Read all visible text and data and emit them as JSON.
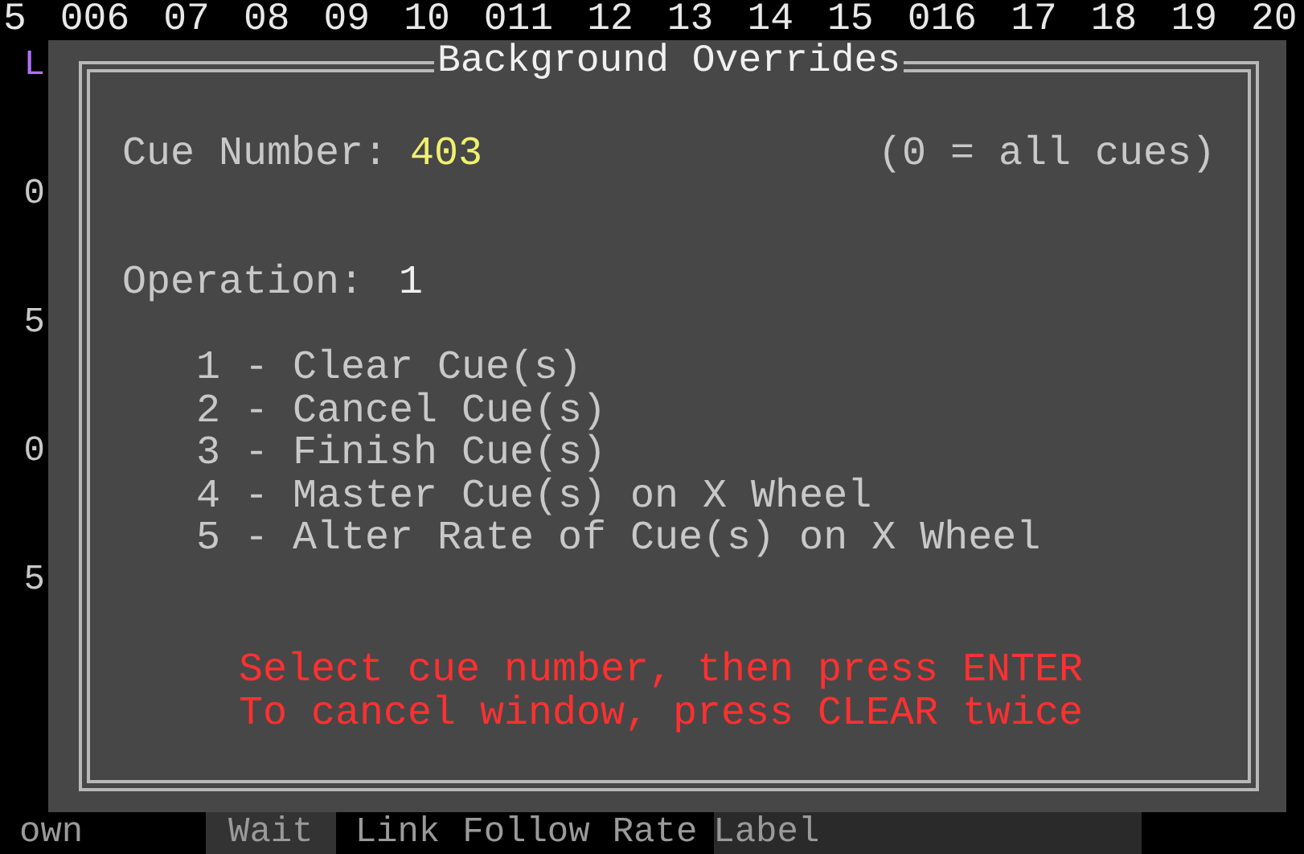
{
  "header_numbers": [
    "5",
    "006",
    "07",
    "08",
    "09",
    "10",
    "011",
    "12",
    "13",
    "14",
    "15",
    "016",
    "17",
    "18",
    "19",
    "20"
  ],
  "left_labels": [
    {
      "text": "L",
      "color": "#b070ff"
    },
    {
      "text": "0",
      "color": "#c8c8c8"
    },
    {
      "text": "5",
      "color": "#c8c8c8"
    },
    {
      "text": "0",
      "color": "#c8c8c8"
    },
    {
      "text": "5",
      "color": "#c8c8c8"
    }
  ],
  "dialog": {
    "title": "Background Overrides",
    "cue_number_label": "Cue Number:",
    "cue_number_value": "403",
    "cue_hint": "(0 = all cues)",
    "operation_label": "Operation:",
    "operation_value": "1",
    "options": [
      "1 - Clear Cue(s)",
      "2 - Cancel Cue(s)",
      "3 - Finish Cue(s)",
      "4 - Master Cue(s) on X Wheel",
      "5 - Alter Rate of Cue(s) on X Wheel"
    ],
    "instructions": [
      "Select cue number, then press ENTER",
      "To cancel window, press CLEAR twice"
    ]
  },
  "bottom_labels": [
    "own",
    "Wait",
    "Link",
    "Follow",
    "Rate",
    "Label"
  ]
}
